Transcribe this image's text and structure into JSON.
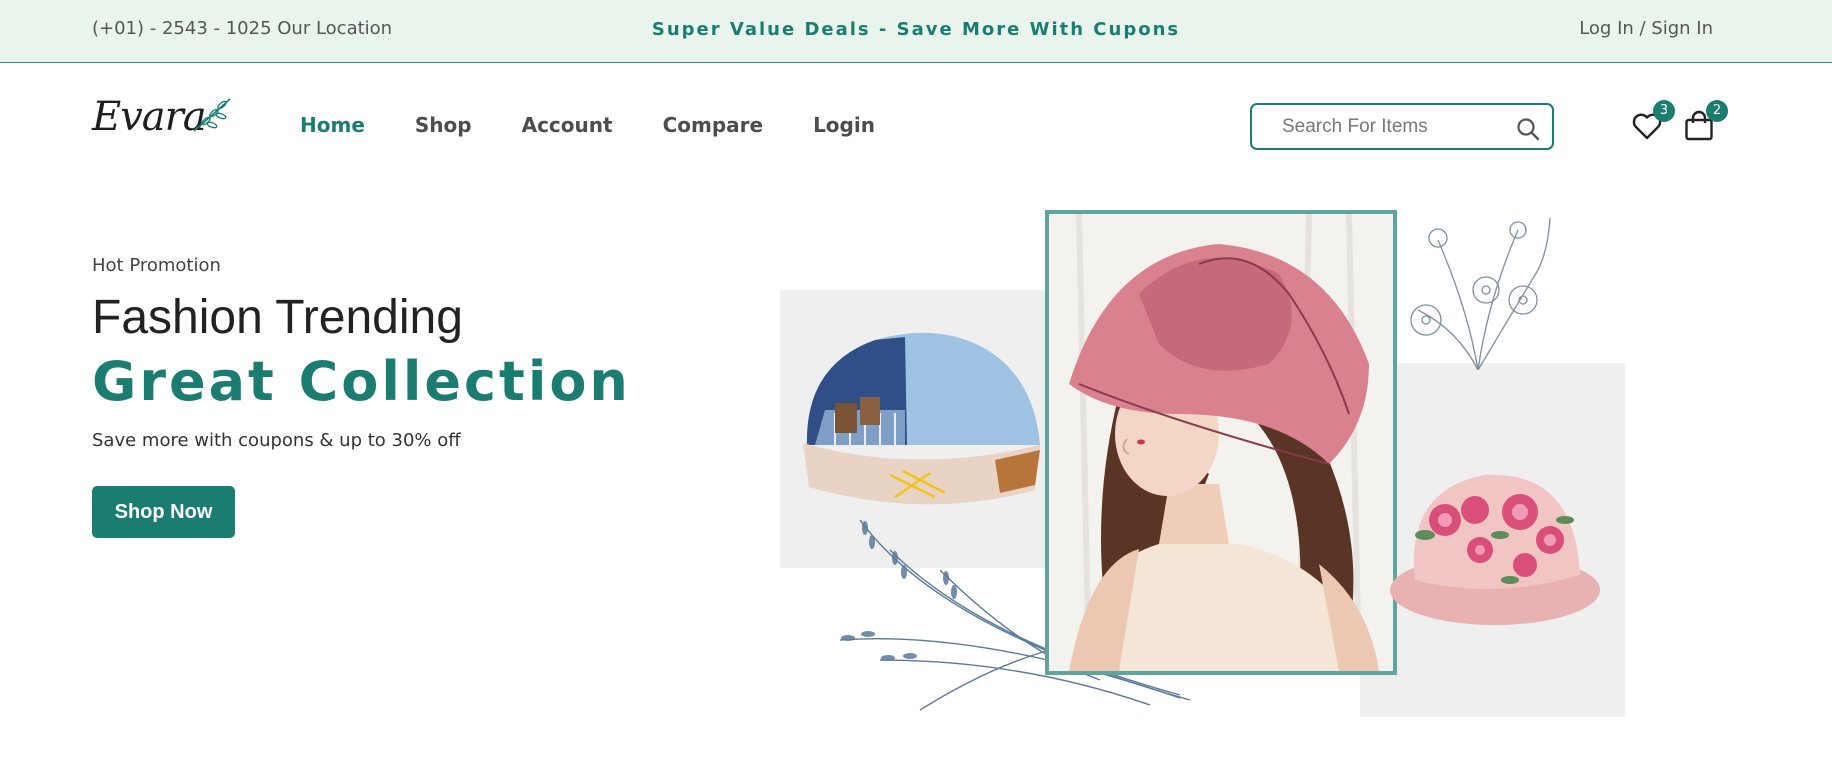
{
  "topbar": {
    "contact": "(+01) - 2543 - 1025 Our Location",
    "promo": "Super Value Deals - Save More With Cupons",
    "auth": "Log In / Sign In"
  },
  "brand": {
    "logo_text": "Evara"
  },
  "nav": {
    "items": [
      {
        "label": "Home",
        "active": true
      },
      {
        "label": "Shop"
      },
      {
        "label": "Account"
      },
      {
        "label": "Compare"
      },
      {
        "label": "Login"
      }
    ]
  },
  "search": {
    "placeholder": "Search For Items"
  },
  "header_icons": {
    "wishlist": {
      "icon": "heart-icon",
      "count": "3"
    },
    "cart": {
      "icon": "shopping-bag-icon",
      "count": "2"
    }
  },
  "hero": {
    "eyebrow": "Hot Promotion",
    "title_line1": "Fashion Trending",
    "title_line2": "Great Collection",
    "subtitle": "Save more with coupons & up to 30% off",
    "cta_label": "Shop Now"
  },
  "colors": {
    "accent": "#1b7d72",
    "topbar_bg": "#e9f5ec",
    "text_dark": "#222222",
    "panel_bg": "#efefef"
  }
}
